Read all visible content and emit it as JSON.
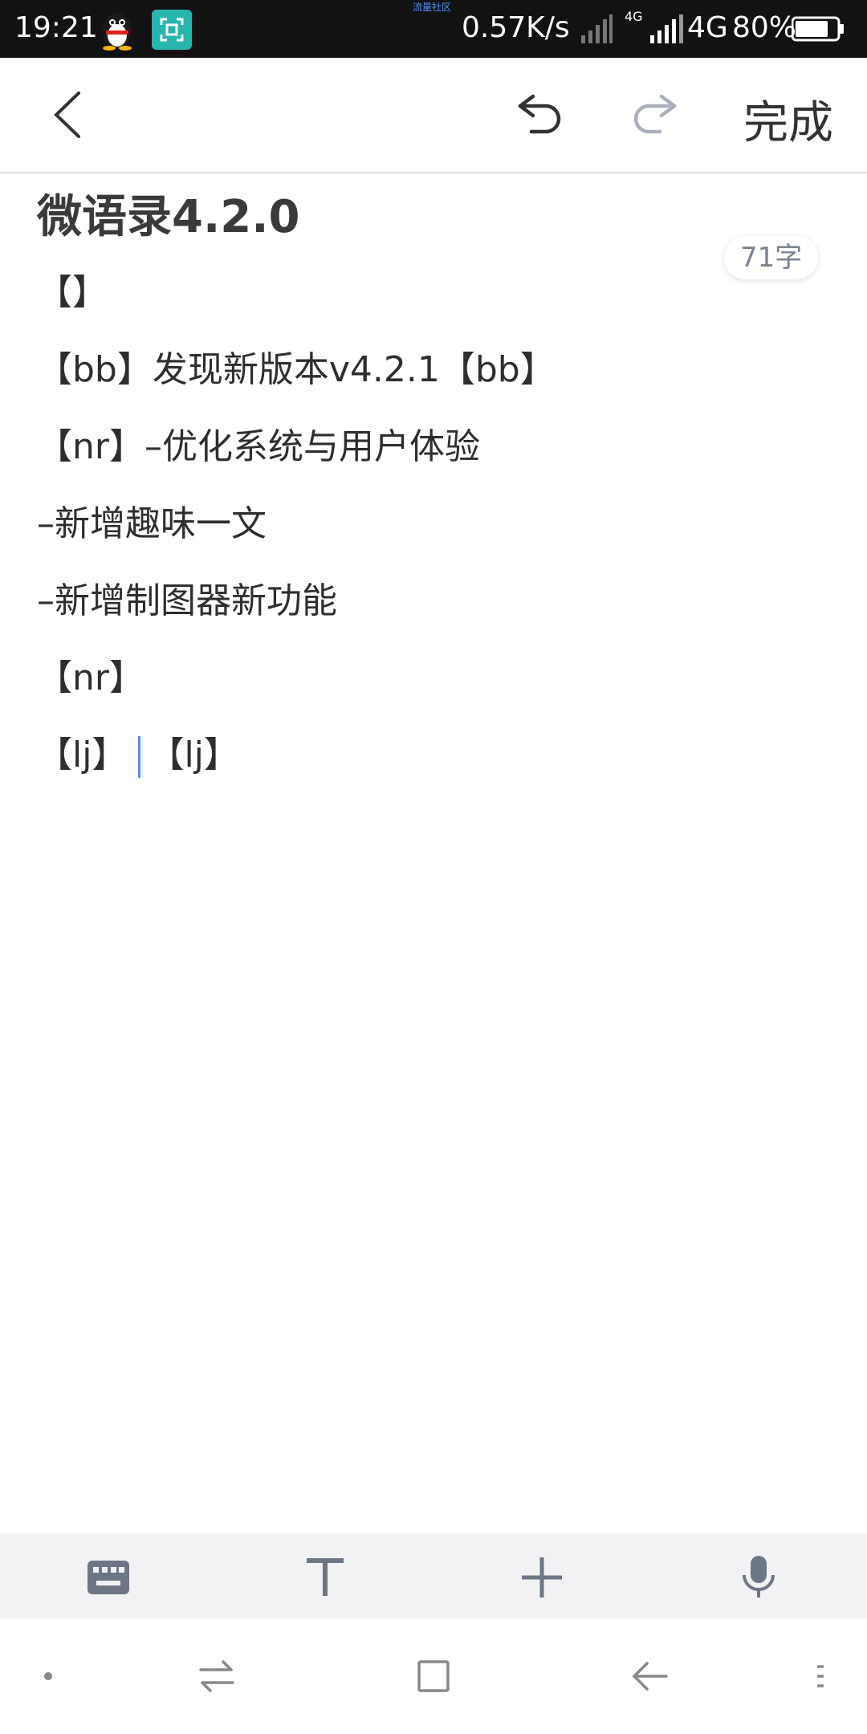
{
  "status_bar": {
    "time": "19:21",
    "carrier_tiny": "流量社区",
    "net_speed": "0.57K/s",
    "net_type": "4G",
    "net_type_small": "4G",
    "battery_percent": "80%",
    "battery_level": 0.8,
    "icons": [
      "qq-icon",
      "scan-icon",
      "signal-icon",
      "battery-icon"
    ]
  },
  "toolbar": {
    "done_label": "完成",
    "icons": [
      "back-chevron-icon",
      "undo-icon",
      "redo-icon"
    ]
  },
  "note": {
    "title": "微语录4.2.0",
    "word_count": "71字",
    "lines": [
      "【】",
      "【bb】发现新版本v4.2.1【bb】",
      "【nr】–优化系统与用户体验",
      "–新增趣味一文",
      "–新增制图器新功能",
      "【nr】"
    ],
    "cursor_line_before": "【lj】",
    "cursor_line_after": "【lj】"
  },
  "edit_bar": {
    "icons": [
      "keyboard-icon",
      "text-format-icon",
      "add-icon",
      "microphone-icon"
    ]
  },
  "nav_bar": {
    "icons": [
      "dot-icon",
      "switch-icon",
      "home-square-icon",
      "back-arrow-icon",
      "menu-icon"
    ]
  },
  "colors": {
    "status_bar_bg": "#121212",
    "accent_cursor": "#4f8ef7",
    "scan_icon_bg": "#26b6ae",
    "edit_bar_bg": "#f2f2f4",
    "icon_gray": "#6d7685"
  }
}
